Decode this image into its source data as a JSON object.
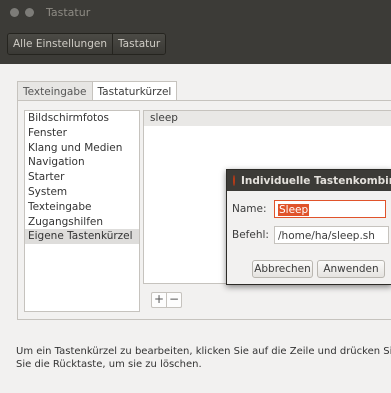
{
  "window": {
    "title": "Tastatur"
  },
  "breadcrumb": {
    "all_settings": "Alle Einstellungen",
    "current": "Tastatur"
  },
  "tabs": [
    {
      "label": "Texteingabe",
      "active": false
    },
    {
      "label": "Tastaturkürzel",
      "active": true
    }
  ],
  "categories": [
    {
      "label": "Bildschirmfotos"
    },
    {
      "label": "Fenster"
    },
    {
      "label": "Klang und Medien"
    },
    {
      "label": "Navigation"
    },
    {
      "label": "Starter"
    },
    {
      "label": "System"
    },
    {
      "label": "Texteingabe"
    },
    {
      "label": "Zugangshilfen"
    },
    {
      "label": "Eigene Tastenkürzel",
      "selected": true
    }
  ],
  "shortcuts": [
    {
      "name": "sleep"
    }
  ],
  "list_buttons": {
    "add": "+",
    "remove": "−"
  },
  "help_text": {
    "line1": "Um ein Tastenkürzel zu bearbeiten, klicken Sie auf die Zeile und drücken Sie d",
    "line2": "Sie die Rücktaste, um sie zu löschen."
  },
  "dialog": {
    "title": "Individuelle Tastenkombin",
    "name_label": "Name:",
    "name_value": "Sleep",
    "command_label": "Befehl:",
    "command_value": "/home/ha/sleep.sh",
    "cancel_label": "Abbrechen",
    "apply_label": "Anwenden"
  },
  "colors": {
    "titlebar": "#3c3b37",
    "accent": "#e0532b",
    "background": "#f2f1f0"
  }
}
